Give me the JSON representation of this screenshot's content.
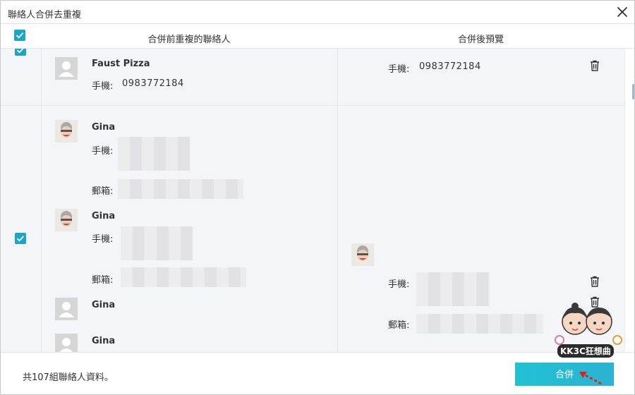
{
  "window": {
    "title": "聯絡人合併去重複"
  },
  "header": {
    "left_title": "合併前重複的聯絡人",
    "right_title": "合併後預覽"
  },
  "groups": [
    {
      "left_contacts": [
        {
          "name": "Faust Pizza",
          "avatar": "placeholder-icon",
          "phone_label": "手機:",
          "phone": "0983772184"
        }
      ],
      "right": {
        "phone_label": "手機:",
        "phone": "0983772184"
      }
    },
    {
      "left_contacts": [
        {
          "name": "Gina",
          "avatar": "gina-photo",
          "phone_label": "手機:",
          "email_label": "郵箱:"
        },
        {
          "name": "Gina",
          "avatar": "gina-photo",
          "phone_label": "手機:",
          "email_label": "郵箱:"
        },
        {
          "name": "Gina",
          "avatar": "placeholder-icon"
        },
        {
          "name": "Gina",
          "avatar": "placeholder-icon"
        }
      ],
      "right": {
        "phone_label": "手機:",
        "email_label": "郵箱:"
      }
    }
  ],
  "footer": {
    "summary": "共107組聯絡人資料。",
    "merge_label": "合併"
  },
  "watermark": {
    "text": "KK3C狂想曲"
  },
  "colors": {
    "accent": "#1aa6c4",
    "merge_button": "#22c2d4",
    "list_bg": "#f3f5f8",
    "arrow": "#e02020"
  }
}
